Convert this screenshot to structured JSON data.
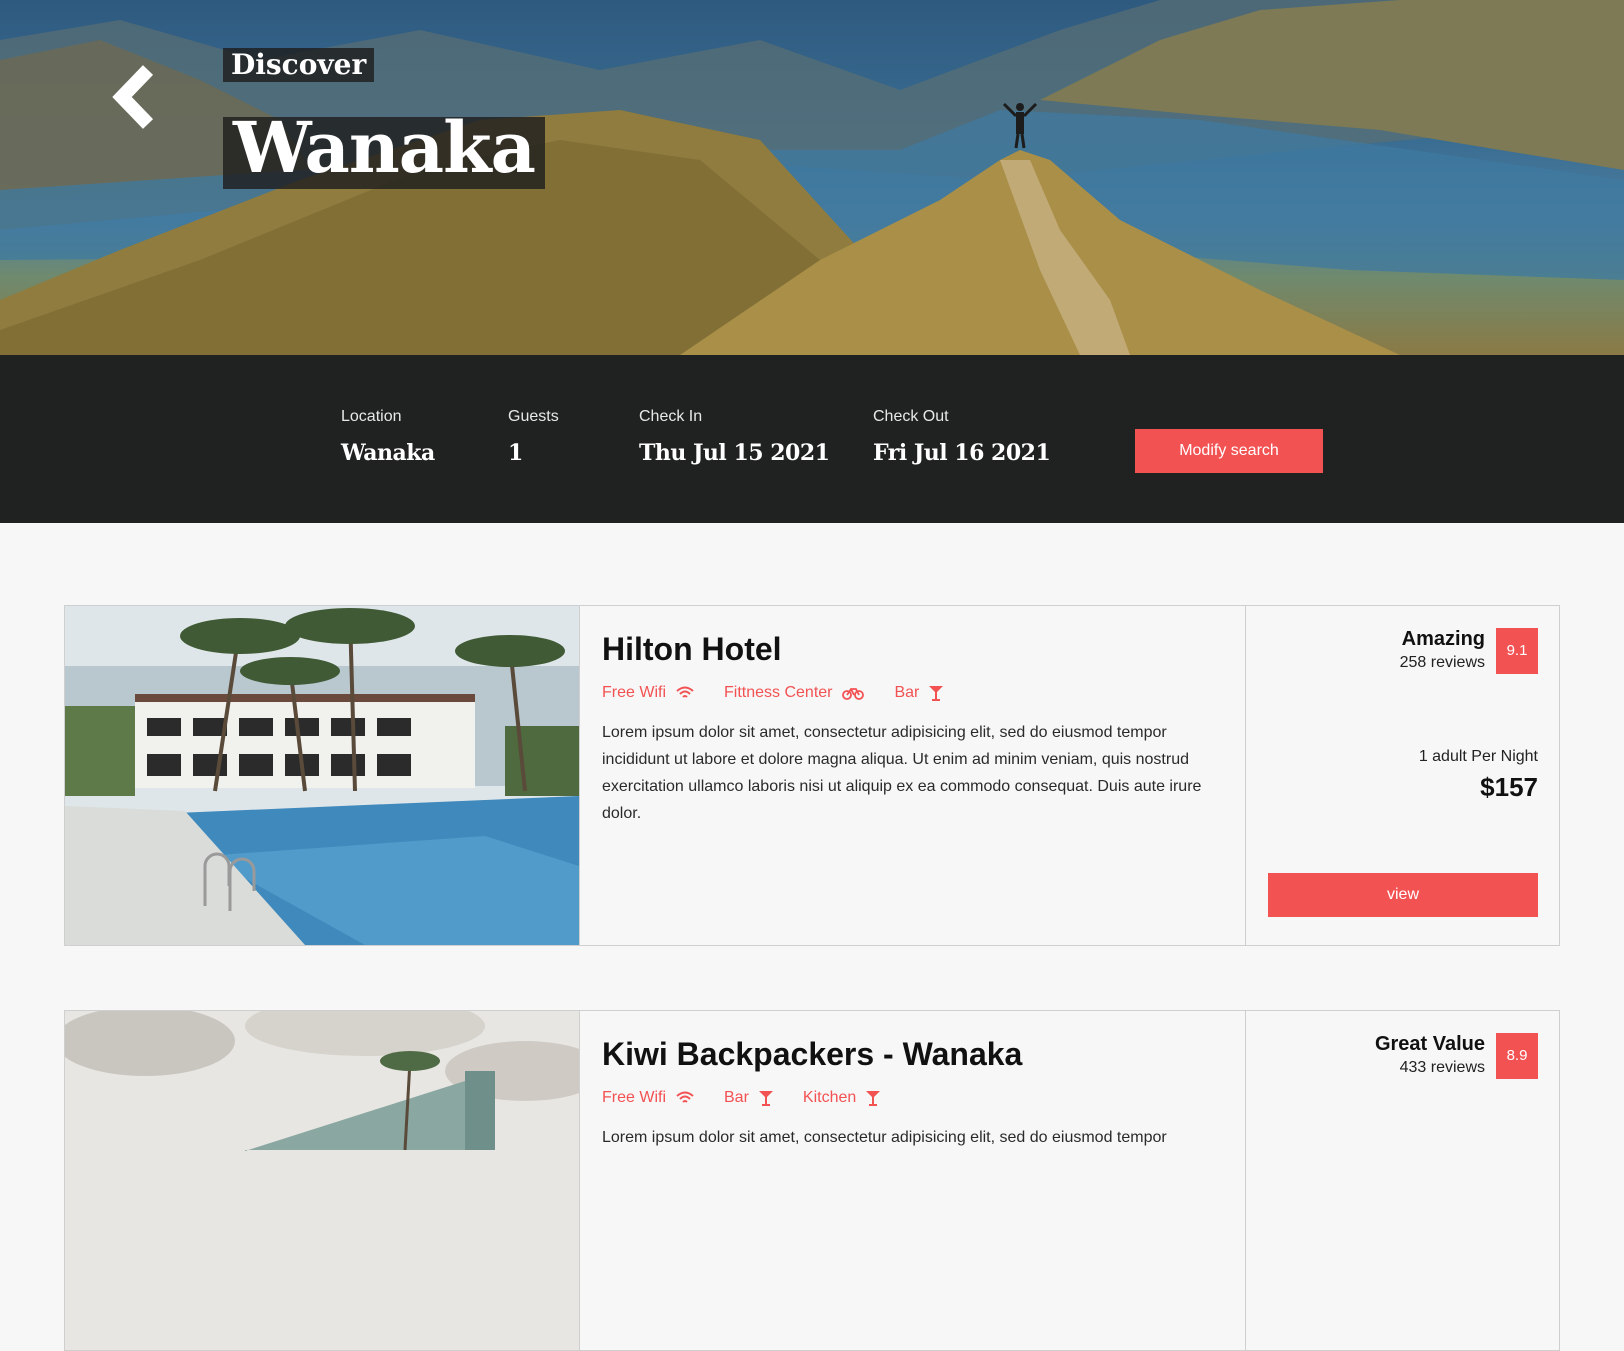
{
  "hero": {
    "subtitle": "Discover",
    "title": "Wanaka"
  },
  "search": {
    "location": {
      "label": "Location",
      "value": "Wanaka"
    },
    "guests": {
      "label": "Guests",
      "value": "1"
    },
    "check_in": {
      "label": "Check In",
      "value": "Thu Jul 15 2021"
    },
    "check_out": {
      "label": "Check Out",
      "value": "Fri Jul 16 2021"
    },
    "modify_label": "Modify search"
  },
  "results": [
    {
      "name": "Hilton Hotel",
      "amenities": [
        {
          "label": "Free Wifi",
          "icon": "wifi-icon"
        },
        {
          "label": "Fittness Center",
          "icon": "bicycle-icon"
        },
        {
          "label": "Bar",
          "icon": "cocktail-icon"
        }
      ],
      "description": "Lorem ipsum dolor sit amet, consectetur adipisicing elit, sed do eiusmod tempor incididunt ut labore et dolore magna aliqua. Ut enim ad minim veniam, quis nostrud exercitation ullamco laboris nisi ut aliquip ex ea commodo consequat. Duis aute irure dolor.",
      "rating_word": "Amazing",
      "reviews": "258 reviews",
      "score": "9.1",
      "per_night": "1 adult Per Night",
      "price": "$157",
      "view_label": "view"
    },
    {
      "name": "Kiwi Backpackers - Wanaka",
      "amenities": [
        {
          "label": "Free Wifi",
          "icon": "wifi-icon"
        },
        {
          "label": "Bar",
          "icon": "cocktail-icon"
        },
        {
          "label": "Kitchen",
          "icon": "cocktail-icon"
        }
      ],
      "description": "Lorem ipsum dolor sit amet, consectetur adipisicing elit, sed do eiusmod tempor",
      "rating_word": "Great Value",
      "reviews": "433 reviews",
      "score": "8.9"
    }
  ],
  "colors": {
    "accent": "#f35253",
    "search_bar": "#202222",
    "background": "#f7f7f7"
  }
}
